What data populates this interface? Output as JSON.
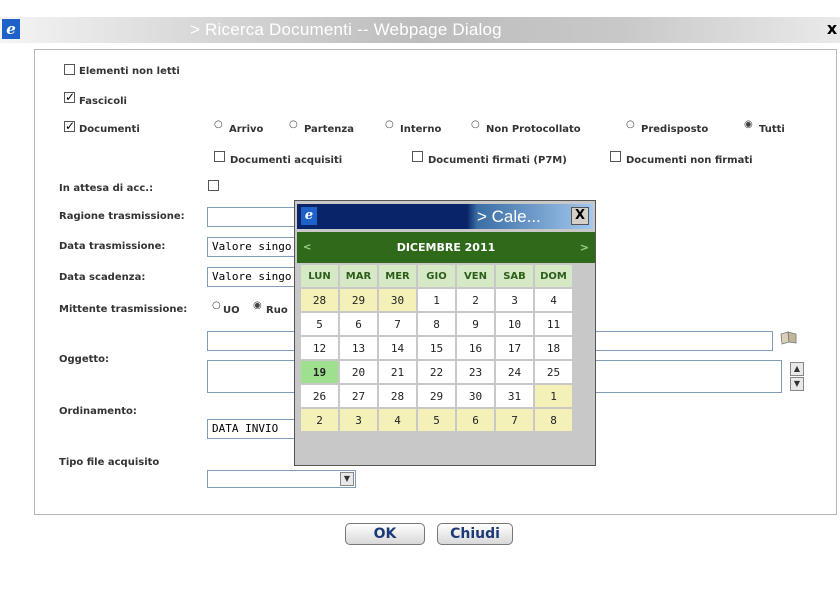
{
  "window": {
    "title": "> Ricerca Documenti -- Webpage Dialog",
    "close_glyph": "x",
    "ie_glyph": "e"
  },
  "form": {
    "elementi_non_letti": {
      "label": "Elementi non letti",
      "checked": false
    },
    "fascicoli": {
      "label": "Fascicoli",
      "checked": true
    },
    "documenti": {
      "label": "Documenti",
      "checked": true
    },
    "doc_types": [
      {
        "label": "Arrivo",
        "selected": false
      },
      {
        "label": "Partenza",
        "selected": false
      },
      {
        "label": "Interno",
        "selected": false
      },
      {
        "label": "Non Protocollato",
        "selected": false
      },
      {
        "label": "Predisposto",
        "selected": false
      },
      {
        "label": "Tutti",
        "selected": true
      }
    ],
    "doc_filters": [
      {
        "label": "Documenti acquisiti",
        "checked": false
      },
      {
        "label": "Documenti firmati (P7M)",
        "checked": false
      },
      {
        "label": "Documenti non firmati",
        "checked": false
      }
    ],
    "in_attesa_label": "In attesa di acc.:",
    "ragione_label": "Ragione trasmissione:",
    "ragione_value": "",
    "data_trasmissione_label": "Data trasmissione:",
    "data_trasmissione_value": "Valore singo",
    "data_scadenza_label": "Data scadenza:",
    "data_scadenza_value": "Valore singo",
    "mittente_label": "Mittente trasmissione:",
    "mittente_options": [
      {
        "label": "UO",
        "selected": false
      },
      {
        "label": "Ruo",
        "selected": true
      }
    ],
    "mittente_value": "",
    "oggetto_label": "Oggetto:",
    "oggetto_value": "",
    "ordinamento_label": "Ordinamento:",
    "ordinamento_value": "DATA INVIO",
    "tipo_file_label": "Tipo file acquisito",
    "tipo_file_value": ""
  },
  "buttons": {
    "ok": "OK",
    "chiudi": "Chiudi"
  },
  "calendar": {
    "title": "> Cale...",
    "close_glyph": "X",
    "ie_glyph": "e",
    "month": "DICEMBRE 2011",
    "prev_glyph": "<",
    "next_glyph": ">",
    "weekdays": [
      "LUN",
      "MAR",
      "MER",
      "GIO",
      "VEN",
      "SAB",
      "DOM"
    ],
    "weeks": [
      [
        "28",
        "29",
        "30",
        "1",
        "2",
        "3",
        "4"
      ],
      [
        "5",
        "6",
        "7",
        "8",
        "9",
        "10",
        "11"
      ],
      [
        "12",
        "13",
        "14",
        "15",
        "16",
        "17",
        "18"
      ],
      [
        "19",
        "20",
        "21",
        "22",
        "23",
        "24",
        "25"
      ],
      [
        "26",
        "27",
        "28",
        "29",
        "30",
        "31",
        "1"
      ],
      [
        "2",
        "3",
        "4",
        "5",
        "6",
        "7",
        "8"
      ]
    ],
    "today": "19",
    "colors": {
      "header": "#2f6a1a",
      "weekday_bg": "#d6e9c6",
      "other_month_bg": "#f3f1b7",
      "today_bg": "#9fe08f"
    }
  }
}
